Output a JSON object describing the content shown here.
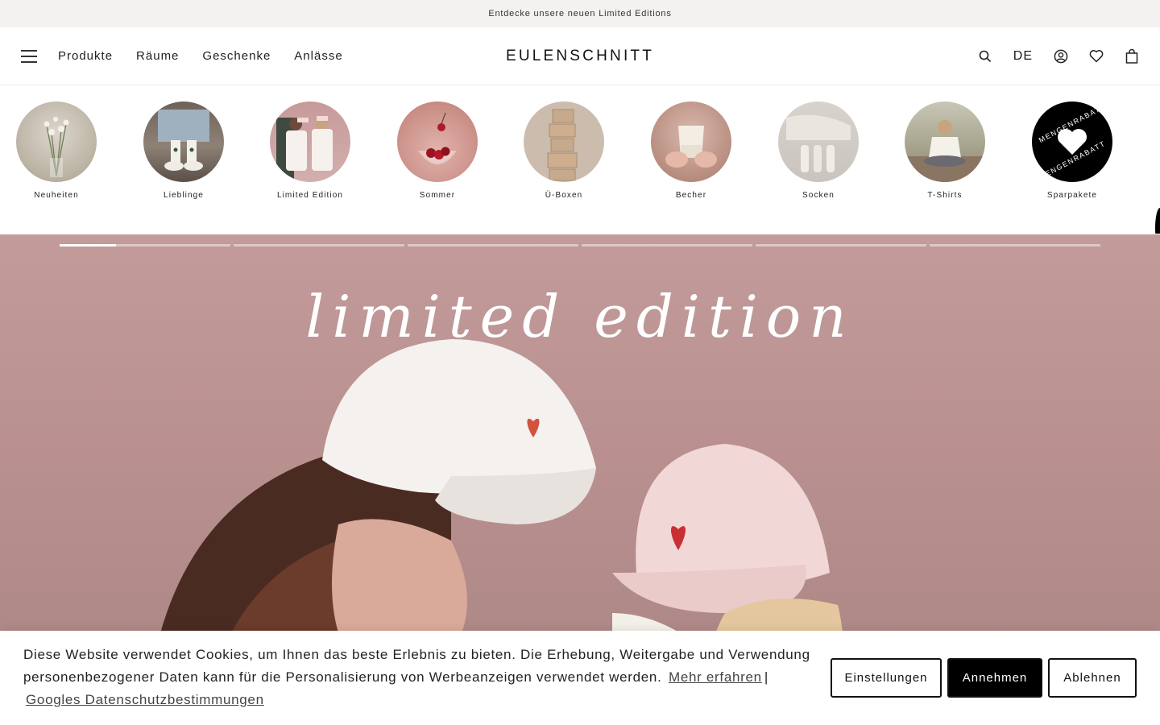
{
  "announcement": "Entdecke unsere neuen Limited Editions",
  "header": {
    "nav": [
      "Produkte",
      "Räume",
      "Geschenke",
      "Anlässe"
    ],
    "logo": "EULENSCHNITT",
    "language": "DE"
  },
  "categories": [
    {
      "label": "Neuheiten",
      "color": "#bfb7a8"
    },
    {
      "label": "Lieblinge",
      "color": "#8e8176"
    },
    {
      "label": "Limited Edition",
      "color": "#c9a3a3"
    },
    {
      "label": "Sommer",
      "color": "#c98e86"
    },
    {
      "label": "Ü-Boxen",
      "color": "#cbbcae"
    },
    {
      "label": "Becher",
      "color": "#b58a7c"
    },
    {
      "label": "Socken",
      "color": "#c9c4bd"
    },
    {
      "label": "T-Shirts",
      "color": "#a7a58e"
    },
    {
      "label": "Sparpakete",
      "badge_top": "MENGENRABATT",
      "badge_bottom": "MENGENRABATT"
    }
  ],
  "hero": {
    "title": "limited edition",
    "slides": 6,
    "active_progress": 0.33
  },
  "cookie": {
    "message": "Diese Website verwendet Cookies, um Ihnen das beste Erlebnis zu bieten. Die Erhebung, Weitergabe und Verwendung personenbezogener Daten kann für die Personalisierung von Werbeanzeigen verwendet werden.",
    "learn_more": "Mehr erfahren",
    "separator": "|",
    "google_link": "Googles Datenschutzbestimmungen",
    "settings_label": "Einstellungen",
    "accept_label": "Annehmen",
    "decline_label": "Ablehnen"
  }
}
